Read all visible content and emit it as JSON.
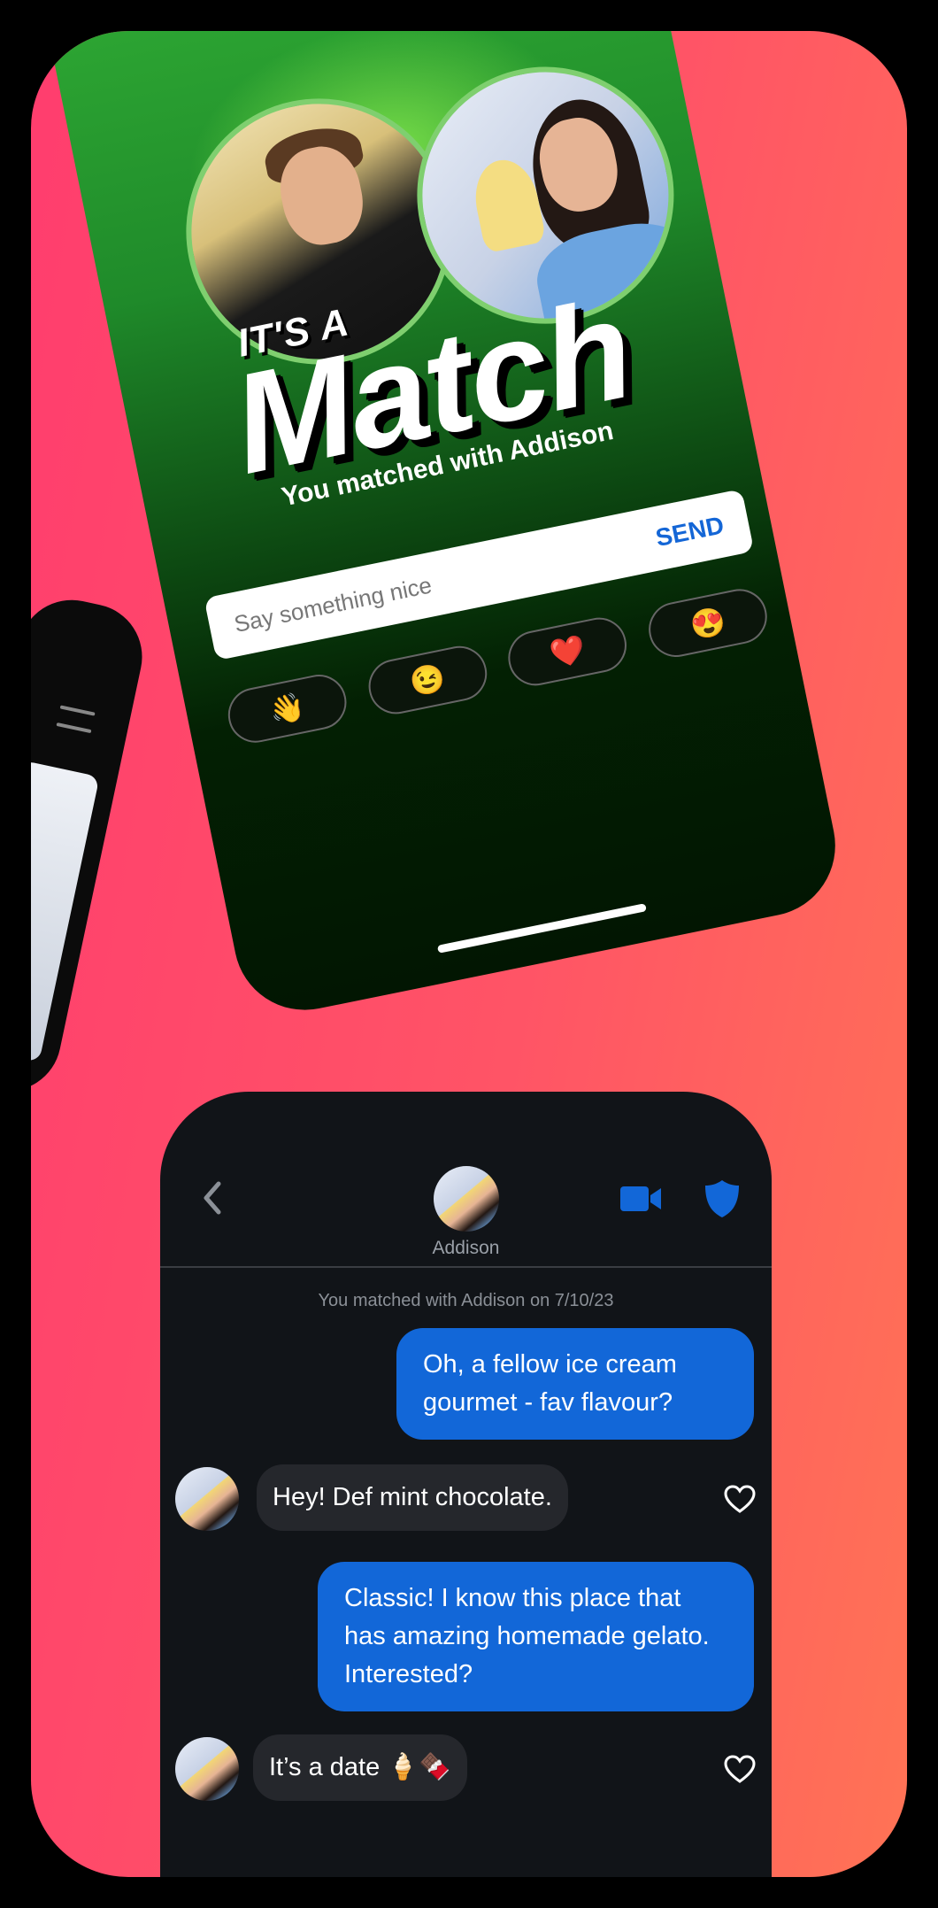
{
  "match_screen": {
    "kicker": "IT'S A",
    "title": "Match",
    "subtitle": "You matched with Addison",
    "input_placeholder": "Say something nice",
    "send_label": "SEND",
    "quick_reactions": [
      "👋",
      "😉",
      "❤️",
      "😍"
    ]
  },
  "chat": {
    "header_name": "Addison",
    "match_date_text": "You matched with Addison on 7/10/23",
    "accent_color": "#1267d8",
    "messages": [
      {
        "from": "me",
        "text": "Oh, a fellow ice cream gourmet - fav flavour?"
      },
      {
        "from": "Addison",
        "text": "Hey! Def mint chocolate."
      },
      {
        "from": "me",
        "text": "Classic! I know this place that has amazing homemade gelato. Interested?"
      },
      {
        "from": "Addison",
        "text": "It’s a date 🍦🍫"
      }
    ]
  }
}
